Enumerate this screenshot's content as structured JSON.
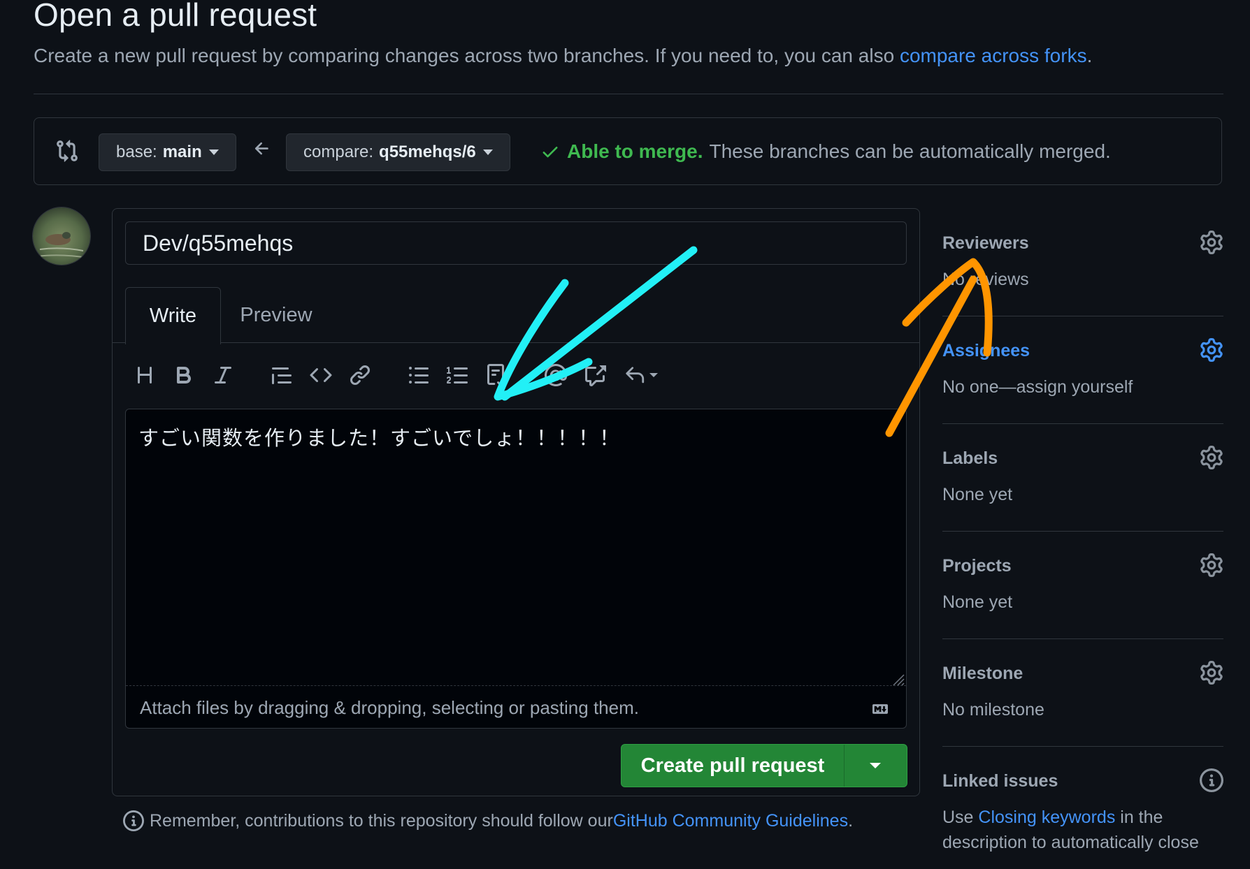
{
  "page": {
    "title": "Open a pull request",
    "subtitle_prefix": "Create a new pull request by comparing changes across two branches. If you need to, you can also ",
    "subtitle_link": "compare across forks",
    "subtitle_suffix": "."
  },
  "range": {
    "base_prefix": "base:",
    "base_branch": "main",
    "compare_prefix": "compare:",
    "compare_branch": "q55mehqs/6",
    "merge_ok": "Able to merge.",
    "merge_text": "These branches can be automatically merged."
  },
  "form": {
    "title_value": "Dev/q55mehqs",
    "tab_write": "Write",
    "tab_preview": "Preview",
    "body_text": "すごい関数を作りました！すごいでしょ！！！！！",
    "attach_text": "Attach files by dragging & dropping, selecting or pasting them.",
    "toolbar_icons": [
      "heading-icon",
      "bold-icon",
      "italic-icon",
      "quote-icon",
      "code-icon",
      "link-icon",
      "unordered-list-icon",
      "ordered-list-icon",
      "task-list-icon",
      "mention-icon",
      "cross-reference-icon",
      "saved-replies-icon"
    ],
    "submit_label": "Create pull request"
  },
  "reminder": {
    "prefix": "Remember, contributions to this repository should follow our ",
    "link": "GitHub Community Guidelines",
    "suffix": "."
  },
  "sidebar": {
    "reviewers": {
      "heading": "Reviewers",
      "value": "No reviews"
    },
    "assignees": {
      "heading": "Assignees",
      "value": "No one—assign yourself"
    },
    "labels": {
      "heading": "Labels",
      "value": "None yet"
    },
    "projects": {
      "heading": "Projects",
      "value": "None yet"
    },
    "milestone": {
      "heading": "Milestone",
      "value": "No milestone"
    },
    "linked_issues": {
      "heading": "Linked issues",
      "prefix": "Use ",
      "link": "Closing keywords",
      "suffix": " in the",
      "line2": "description to automatically close"
    }
  },
  "colors": {
    "background": "#0d1117",
    "link": "#4493f8",
    "success": "#3fb950",
    "primary_button": "#238636",
    "annotation_cyan": "#22f0f6",
    "annotation_orange": "#ff9500"
  }
}
